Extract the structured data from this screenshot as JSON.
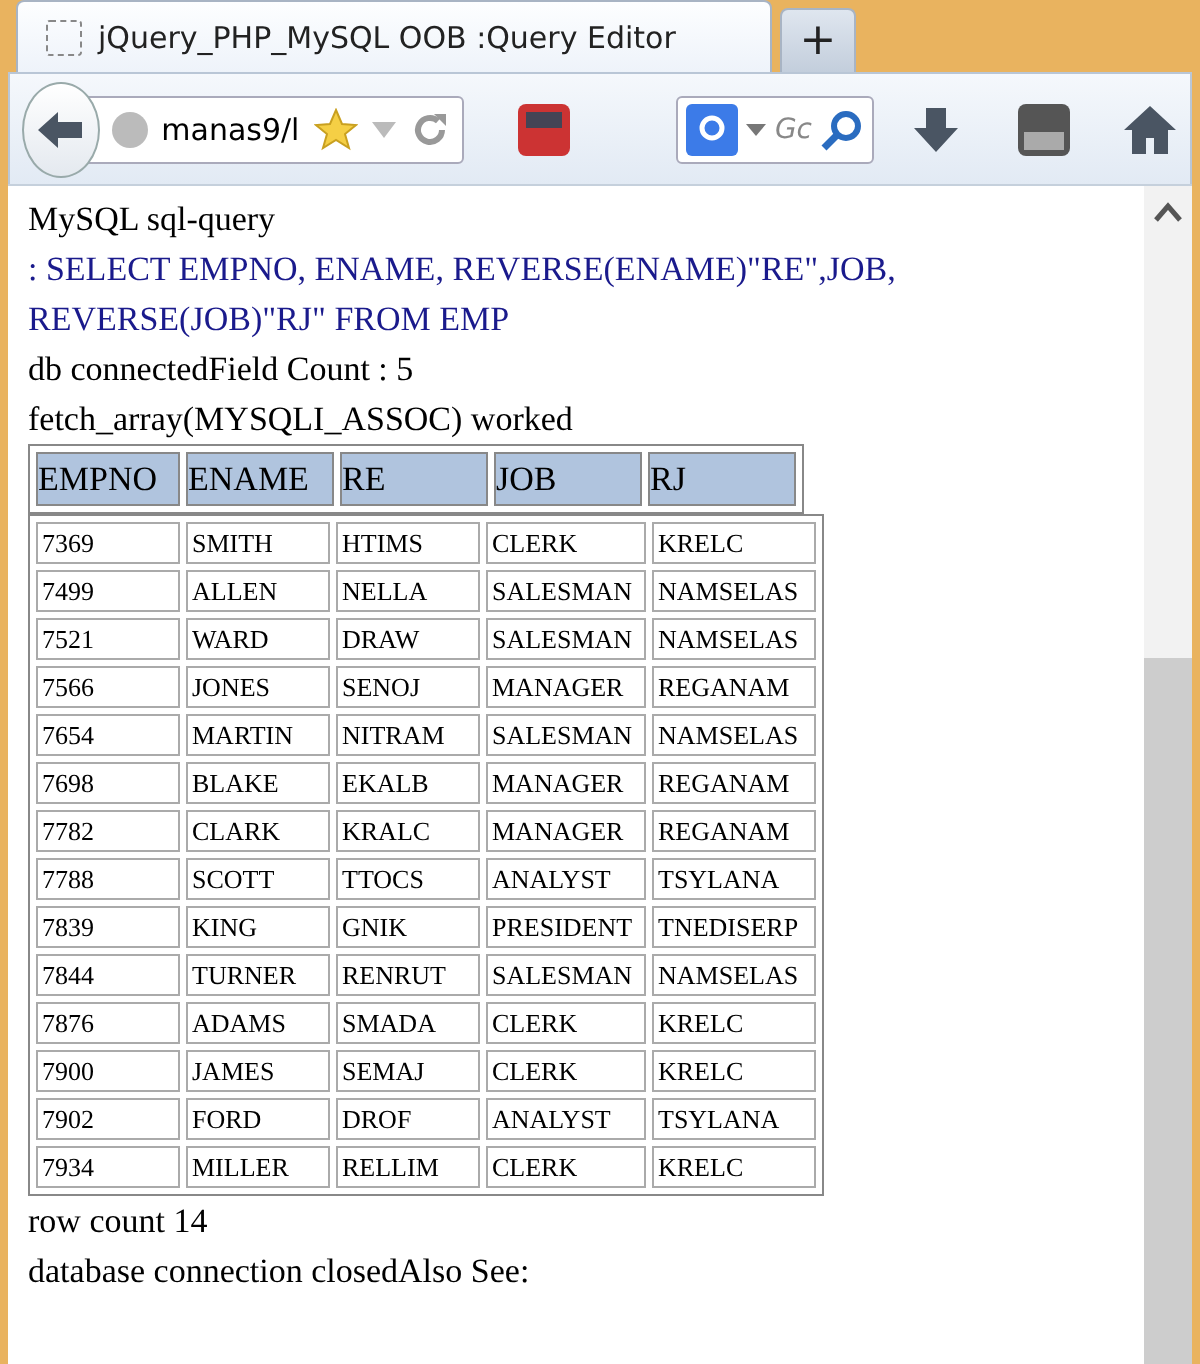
{
  "tabs": [
    {
      "title": "jQuery_PHP_MySQL OOB :Query Editor",
      "selected": true
    },
    {
      "title": "+",
      "selected": false
    }
  ],
  "toolbar": {
    "url": "manas9/l",
    "search_placeholder": "Gc"
  },
  "content": {
    "lines": [
      {
        "kind": "plain",
        "text": "MySQL sql-query"
      },
      {
        "kind": "query",
        "text": ": SELECT EMPNO, ENAME, REVERSE(ENAME)\"RE\",JOB, REVERSE(JOB)\"RJ\" FROM EMP"
      },
      {
        "kind": "plain",
        "text": "db connectedField Count : 5"
      },
      {
        "kind": "plain",
        "text": "fetch_array(MYSQLI_ASSOC) worked"
      }
    ],
    "table": {
      "columns": [
        "EMPNO",
        "ENAME",
        "RE",
        "JOB",
        "RJ"
      ],
      "rows": [
        [
          "7369",
          "SMITH",
          "HTIMS",
          "CLERK",
          "KRELC"
        ],
        [
          "7499",
          "ALLEN",
          "NELLA",
          "SALESMAN",
          "NAMSELAS"
        ],
        [
          "7521",
          "WARD",
          "DRAW",
          "SALESMAN",
          "NAMSELAS"
        ],
        [
          "7566",
          "JONES",
          "SENOJ",
          "MANAGER",
          "REGANAM"
        ],
        [
          "7654",
          "MARTIN",
          "NITRAM",
          "SALESMAN",
          "NAMSELAS"
        ],
        [
          "7698",
          "BLAKE",
          "EKALB",
          "MANAGER",
          "REGANAM"
        ],
        [
          "7782",
          "CLARK",
          "KRALC",
          "MANAGER",
          "REGANAM"
        ],
        [
          "7788",
          "SCOTT",
          "TTOCS",
          "ANALYST",
          "TSYLANA"
        ],
        [
          "7839",
          "KING",
          "GNIK",
          "PRESIDENT",
          "TNEDISERP"
        ],
        [
          "7844",
          "TURNER",
          "RENRUT",
          "SALESMAN",
          "NAMSELAS"
        ],
        [
          "7876",
          "ADAMS",
          "SMADA",
          "CLERK",
          "KRELC"
        ],
        [
          "7900",
          "JAMES",
          "SEMAJ",
          "CLERK",
          "KRELC"
        ],
        [
          "7902",
          "FORD",
          "DROF",
          "ANALYST",
          "TSYLANA"
        ],
        [
          "7934",
          "MILLER",
          "RELLIM",
          "CLERK",
          "KRELC"
        ]
      ]
    },
    "footer": [
      "row count 14",
      "database connection closedAlso See:"
    ]
  }
}
